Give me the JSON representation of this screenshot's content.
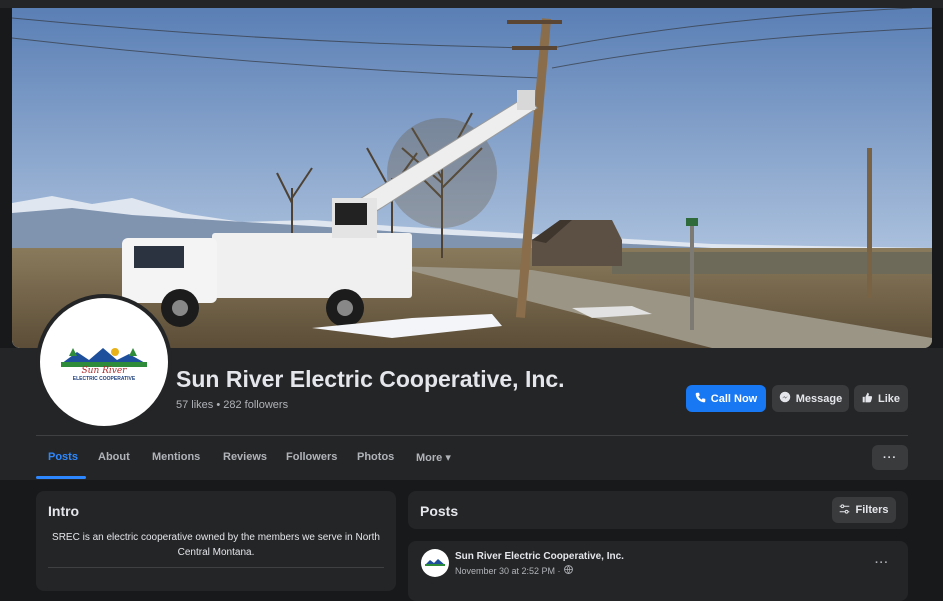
{
  "page": {
    "name": "Sun River Electric Cooperative, Inc.",
    "stats": "57 likes • 282 followers",
    "logo_text": "Sun River",
    "logo_subtext": "ELECTRIC COOPERATIVE"
  },
  "actions": {
    "call_now": "Call Now",
    "message": "Message",
    "like": "Like",
    "more": "···"
  },
  "tabs": [
    {
      "label": "Posts",
      "active": true
    },
    {
      "label": "About"
    },
    {
      "label": "Mentions"
    },
    {
      "label": "Reviews"
    },
    {
      "label": "Followers"
    },
    {
      "label": "Photos"
    },
    {
      "label": "More ▾"
    }
  ],
  "intro": {
    "title": "Intro",
    "text": "SREC is an electric cooperative owned by the members we serve in North Central Montana."
  },
  "posts": {
    "title": "Posts",
    "filters": "Filters",
    "author": "Sun River Electric Cooperative, Inc.",
    "time": "November 30 at 2:52 PM ·",
    "menu": "···"
  },
  "colors": {
    "accent": "#1877f2",
    "background": "#18191a",
    "card": "#242526"
  }
}
